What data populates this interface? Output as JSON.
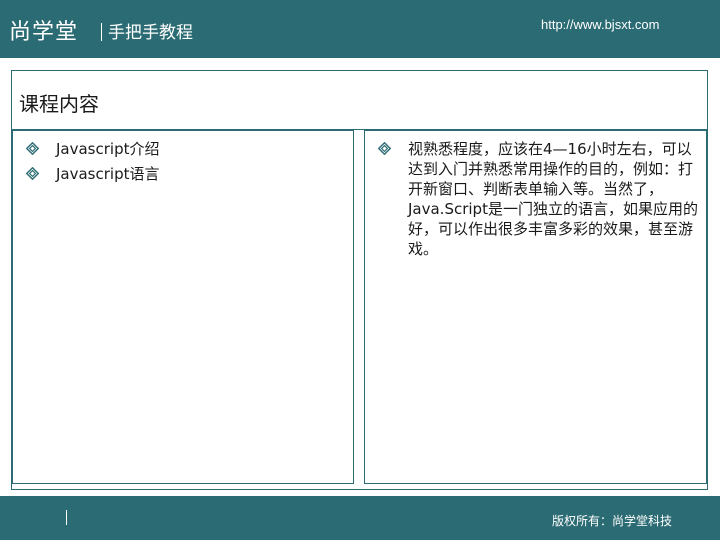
{
  "header": {
    "brand": "尚学堂",
    "tagline": "手把手教程",
    "url": "http://www.bjsxt.com"
  },
  "slide": {
    "title": "课程内容",
    "left_items": [
      "Javascript介绍",
      "Javascript语言"
    ],
    "right_text": "视熟悉程度，应该在4—16小时左右，可以达到入门并熟悉常用操作的目的，例如：打开新窗口、判断表单输入等。当然了，Java.Script是一门独立的语言，如果应用的好，可以作出很多丰富多彩的效果，甚至游戏。"
  },
  "footer": {
    "copyright": "版权所有：尚学堂科技"
  },
  "colors": {
    "theme": "#2b6b73",
    "bullet": "#2b6b73"
  },
  "icons": {
    "bullet": "diamond-bullet-icon"
  }
}
